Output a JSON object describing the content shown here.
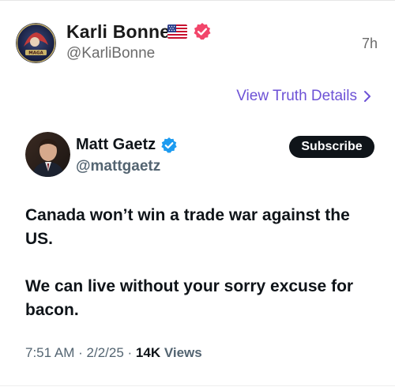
{
  "post": {
    "author_name": "Karli Bonne’",
    "author_handle": "@KarliBonne",
    "time": "7h",
    "flag_icon": "us-flag-icon",
    "badge_color": "#f2456a",
    "avatar_text": "MAGA",
    "view_details_label": "View Truth Details",
    "link_color": "#6d52d6"
  },
  "tweet": {
    "author_name": "Matt Gaetz",
    "author_handle": "@mattgaetz",
    "verified_color": "#1d9bf0",
    "subscribe_label": "Subscribe",
    "text_paragraphs": [
      "Canada won’t win a trade war against the US.",
      "We can live without your sorry excuse for bacon."
    ],
    "time": "7:51 AM",
    "separator": "·",
    "date": "2/2/25",
    "views_count": "14K",
    "views_label": "Views"
  }
}
